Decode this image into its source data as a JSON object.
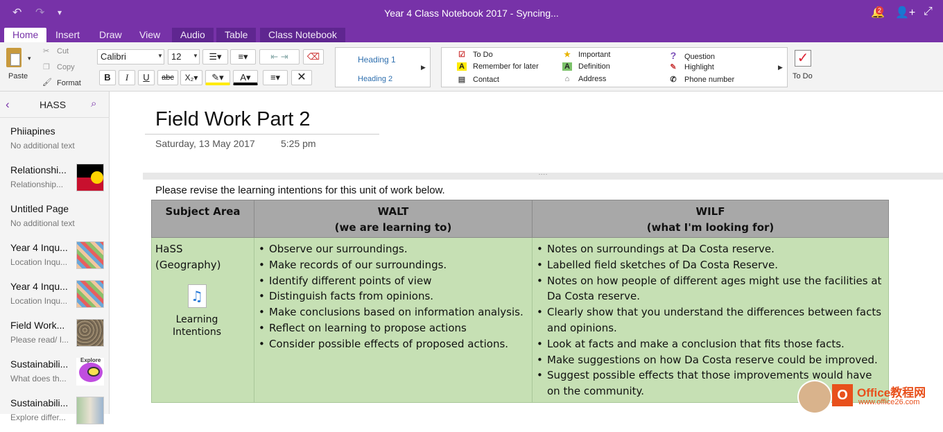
{
  "window": {
    "title": "Year 4 Class Notebook 2017 - Syncing...",
    "notification_count": "2"
  },
  "tabs": [
    {
      "label": "Home"
    },
    {
      "label": "Insert"
    },
    {
      "label": "Draw"
    },
    {
      "label": "View"
    },
    {
      "label": "Audio"
    },
    {
      "label": "Table"
    },
    {
      "label": "Class Notebook"
    }
  ],
  "ribbon": {
    "paste": "Paste",
    "cut": "Cut",
    "copy": "Copy",
    "format": "Format",
    "font": "Calibri",
    "size": "12",
    "heading1": "Heading 1",
    "heading2": "Heading 2",
    "tags": [
      "To Do",
      "Remember for later",
      "Contact",
      "Important",
      "Definition",
      "Address",
      "Question",
      "Highlight",
      "Phone number"
    ],
    "todo_label": "To Do"
  },
  "sidebar": {
    "section": "HASS",
    "pages": [
      {
        "title": "Phiiapines",
        "subtitle": "No additional text"
      },
      {
        "title": "Relationshi...",
        "subtitle": "Relationship..."
      },
      {
        "title": "Untitled Page",
        "subtitle": "No additional text"
      },
      {
        "title": "Year 4 Inqu...",
        "subtitle": "Location Inqu..."
      },
      {
        "title": "Year 4 Inqu...",
        "subtitle": "Location Inqu..."
      },
      {
        "title": "Field Work...",
        "subtitle": "Please read/ I..."
      },
      {
        "title": "Sustainabili...",
        "subtitle": "What does th..."
      },
      {
        "title": "Sustainabili...",
        "subtitle": "Explore differ..."
      }
    ],
    "thumb_explore": "Explore"
  },
  "page": {
    "title": "Field Work Part 2",
    "date": "Saturday, 13 May 2017",
    "time": "5:25 pm",
    "instruction": "Please revise the learning intentions for this unit of work below.",
    "table": {
      "headers": [
        "Subject Area",
        "WALT",
        "(we are learning to)",
        "WILF",
        "(what I'm looking for)"
      ],
      "subject": "HaSS (Geography)",
      "attachment": "Learning Intentions",
      "walt": [
        "Observe our surroundings.",
        "Make records of our surroundings.",
        "Identify different points of view",
        "Distinguish facts from opinions.",
        "Make conclusions based on information analysis.",
        "Reflect on learning to propose actions",
        "Consider possible effects of proposed actions."
      ],
      "wilf": [
        "Notes on surroundings at Da Costa reserve.",
        "Labelled field sketches of Da Costa Reserve.",
        "Notes on how people of different ages might use the facilities at Da Costa reserve.",
        "Clearly show that you understand the differences between facts and opinions.",
        "Look at facts and make a conclusion that fits those facts.",
        "Make suggestions on how Da Costa reserve could be improved.",
        "Suggest possible effects that those improvements would have on the community."
      ]
    }
  },
  "watermark": {
    "brand": "Office教程网",
    "url": "www.office26.com"
  },
  "colors": {
    "accent": "#7732a8",
    "table_header": "#a8a8a8",
    "table_body": "#c6e0b4"
  }
}
